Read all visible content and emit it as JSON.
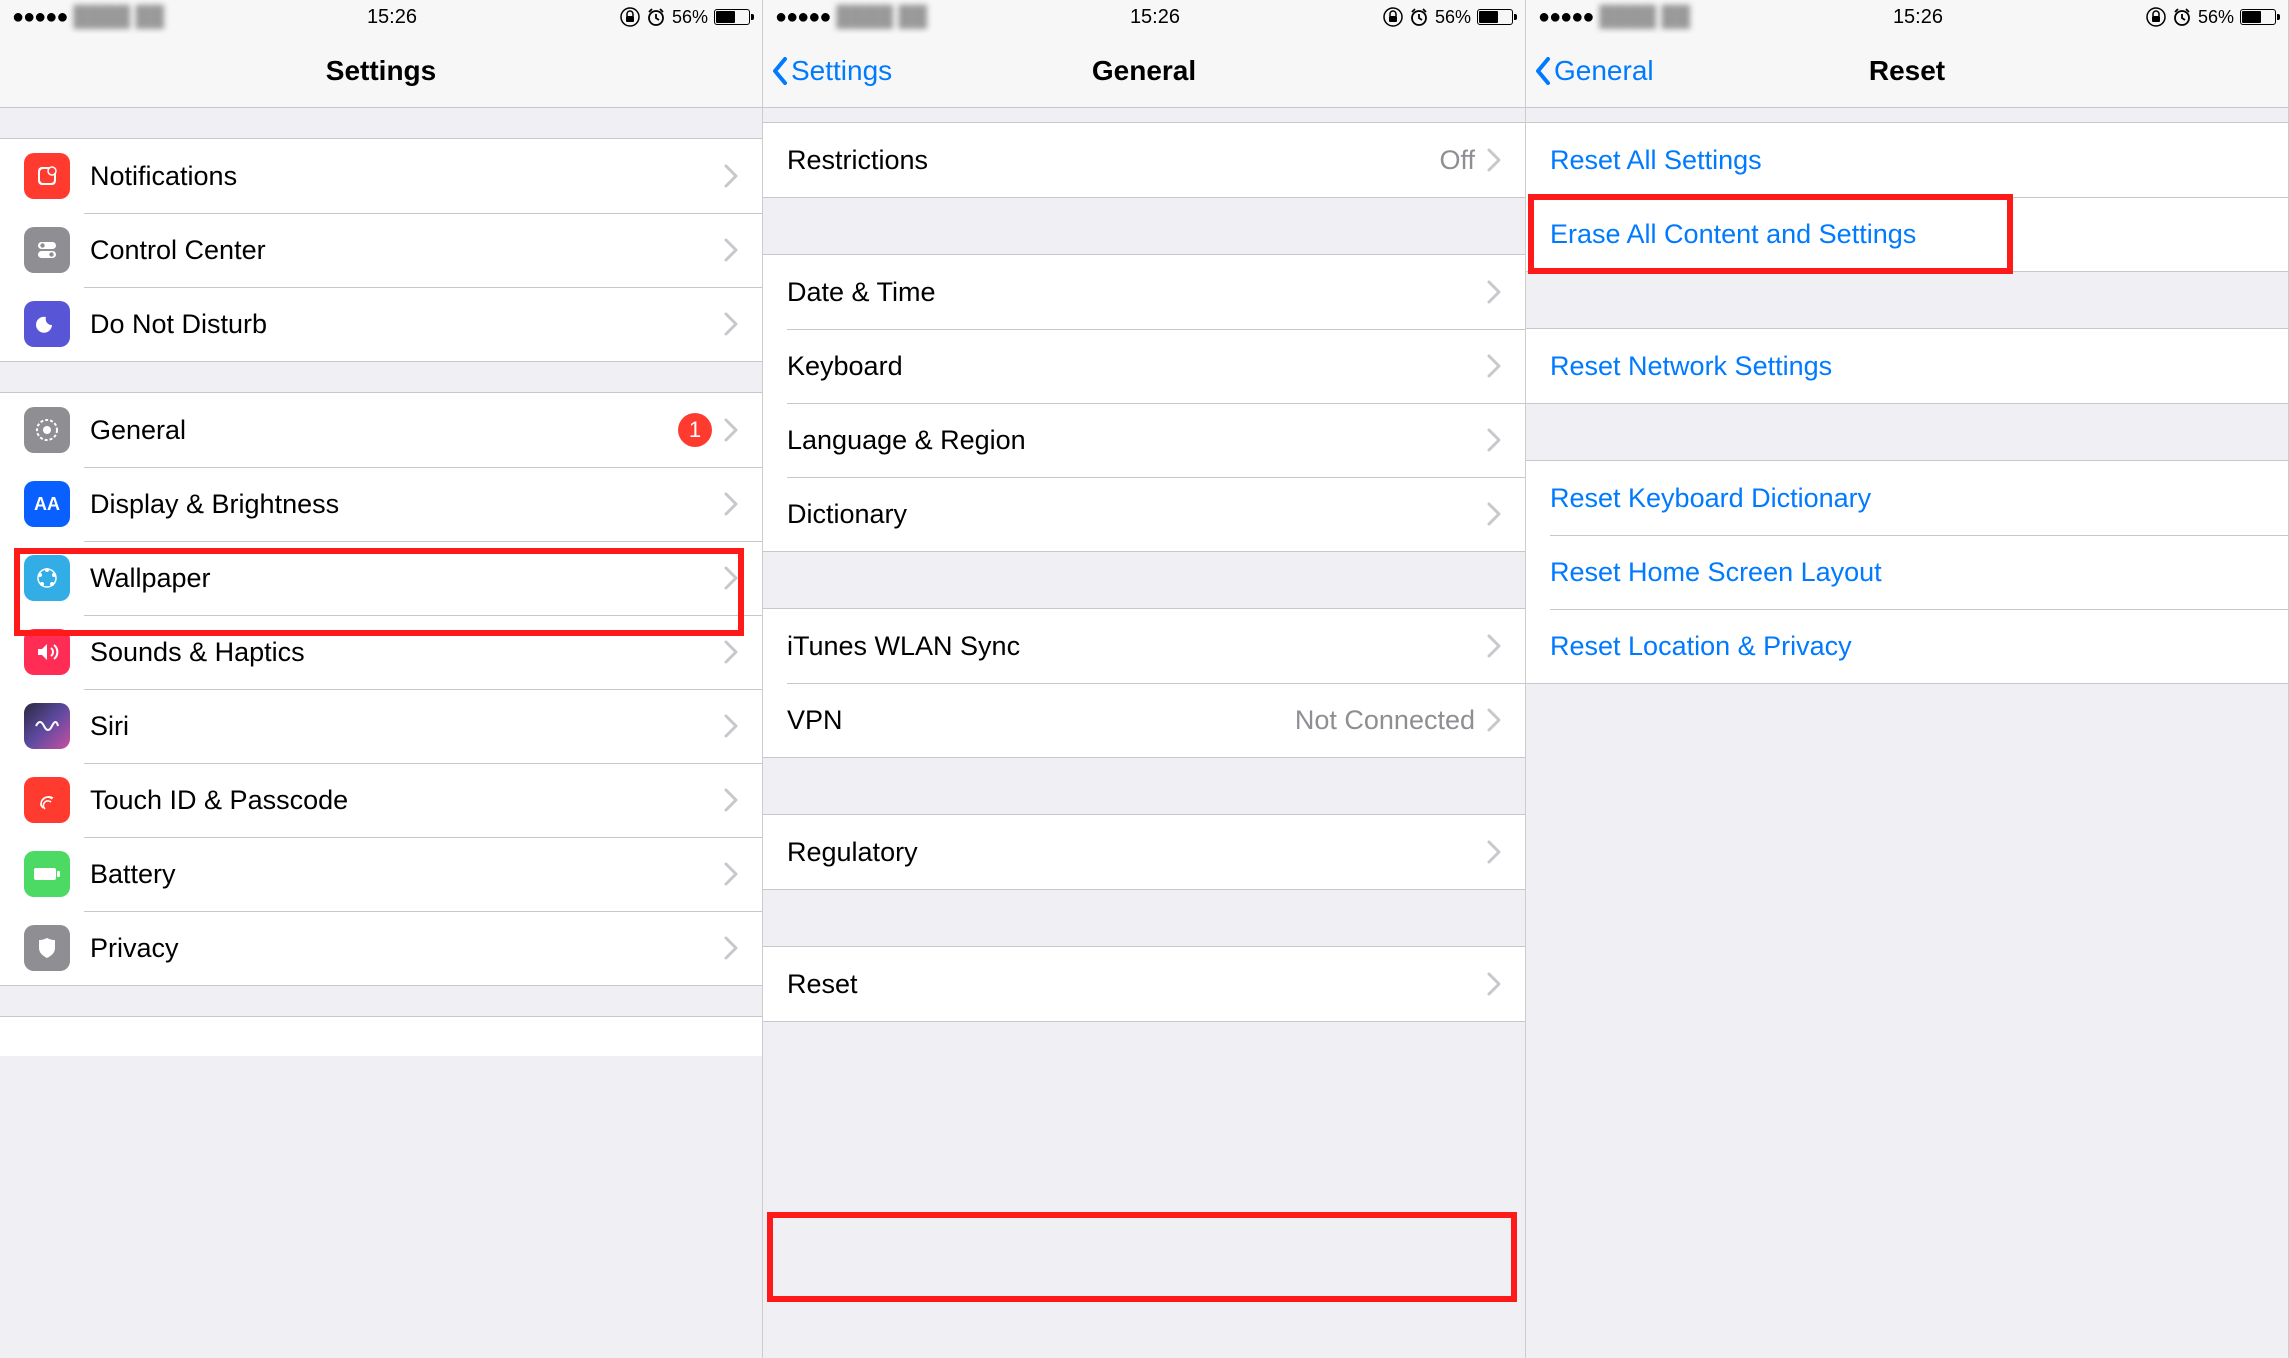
{
  "statusbar": {
    "time": "15:26",
    "battery_pct": "56%",
    "carrier_blur": "████ ██"
  },
  "screen1": {
    "nav_title": "Settings",
    "rows_g1": [
      {
        "label": "Notifications"
      },
      {
        "label": "Control Center"
      },
      {
        "label": "Do Not Disturb"
      }
    ],
    "rows_g2": [
      {
        "label": "General",
        "badge": "1"
      },
      {
        "label": "Display & Brightness"
      },
      {
        "label": "Wallpaper"
      },
      {
        "label": "Sounds & Haptics"
      },
      {
        "label": "Siri"
      },
      {
        "label": "Touch ID & Passcode"
      },
      {
        "label": "Battery"
      },
      {
        "label": "Privacy"
      }
    ]
  },
  "screen2": {
    "nav_back": "Settings",
    "nav_title": "General",
    "rows_g1": [
      {
        "label": "Restrictions",
        "value": "Off"
      }
    ],
    "rows_g2": [
      {
        "label": "Date & Time"
      },
      {
        "label": "Keyboard"
      },
      {
        "label": "Language & Region"
      },
      {
        "label": "Dictionary"
      }
    ],
    "rows_g3": [
      {
        "label": "iTunes WLAN Sync"
      },
      {
        "label": "VPN",
        "value": "Not Connected"
      }
    ],
    "rows_g4": [
      {
        "label": "Regulatory"
      }
    ],
    "rows_g5": [
      {
        "label": "Reset"
      }
    ]
  },
  "screen3": {
    "nav_back": "General",
    "nav_title": "Reset",
    "rows_g1": [
      {
        "label": "Reset All Settings"
      },
      {
        "label": "Erase All Content and Settings"
      }
    ],
    "rows_g2": [
      {
        "label": "Reset Network Settings"
      }
    ],
    "rows_g3": [
      {
        "label": "Reset Keyboard Dictionary"
      },
      {
        "label": "Reset Home Screen Layout"
      },
      {
        "label": "Reset Location & Privacy"
      }
    ]
  }
}
